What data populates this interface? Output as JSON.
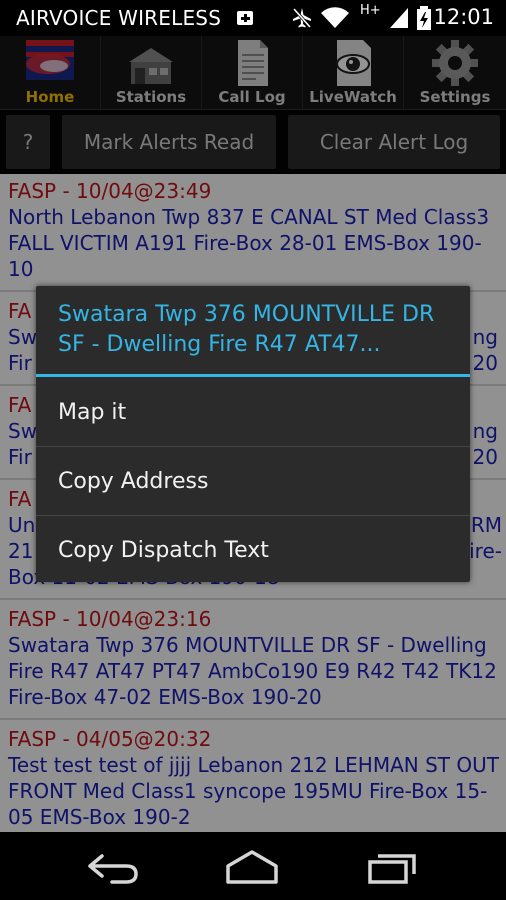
{
  "status_bar": {
    "carrier": "AIRVOICE WIRELESS",
    "network_type": "H+",
    "time": "12:01",
    "icons": [
      "notification-plus-icon",
      "airplane-off-icon",
      "wifi-icon",
      "signal-icon",
      "battery-charging-icon"
    ]
  },
  "tabs": [
    {
      "label": "Home",
      "icon": "home-flag-icon",
      "active": true
    },
    {
      "label": "Stations",
      "icon": "stations-building-icon",
      "active": false
    },
    {
      "label": "Call Log",
      "icon": "document-icon",
      "active": false
    },
    {
      "label": "LiveWatch",
      "icon": "eye-icon",
      "active": false
    },
    {
      "label": "Settings",
      "icon": "gear-icon",
      "active": false
    }
  ],
  "actions": {
    "help_label": "?",
    "mark_read_label": "Mark Alerts Read",
    "clear_log_label": "Clear Alert Log"
  },
  "alerts": [
    {
      "header": "FASP - 10/04@23:49",
      "body": "North Lebanon Twp 837 E CANAL ST Med Class3 FALL VICTIM A191 Fire-Box 28-01 EMS-Box 190-10"
    },
    {
      "header": "FA",
      "body_left": [
        "Sw",
        "Fir"
      ],
      "body_right": [
        "ng",
        "20"
      ]
    },
    {
      "header": "FA",
      "body_left": [
        "Sw",
        "Fir"
      ],
      "body_right": [
        "ng",
        "20"
      ]
    },
    {
      "header": "FA",
      "body_left": [
        "Un",
        "21"
      ],
      "body_right": [
        "RM",
        "ire-"
      ],
      "body_tail": "Box 11-02 EMS-Box 190-18"
    },
    {
      "header": "FASP - 10/04@23:16",
      "body": "Swatara Twp 376 MOUNTVILLE DR SF - Dwelling Fire R47 AT47 PT47 AmbCo190 E9 R42 T42 TK12 Fire-Box 47-02 EMS-Box 190-20"
    },
    {
      "header": "FASP - 04/05@20:32",
      "body": "Test test test of jjjj Lebanon 212 LEHMAN ST OUT FRONT Med Class1 syncope 195MU Fire-Box 15-05 EMS-Box 190-2"
    }
  ],
  "dialog": {
    "title": "Swatara Twp 376 MOUNTVILLE DR SF - Dwelling Fire R47 AT47...",
    "items": [
      "Map it",
      "Copy Address",
      "Copy Dispatch Text"
    ]
  },
  "navigation": {
    "buttons": [
      "back-icon",
      "home-icon",
      "recent-apps-icon"
    ]
  },
  "colors": {
    "accent_blue": "#33b5e5",
    "alert_header_red": "#c1141a",
    "alert_body_blue": "#1b1fb4",
    "active_tab_yellow": "#f6c000"
  }
}
